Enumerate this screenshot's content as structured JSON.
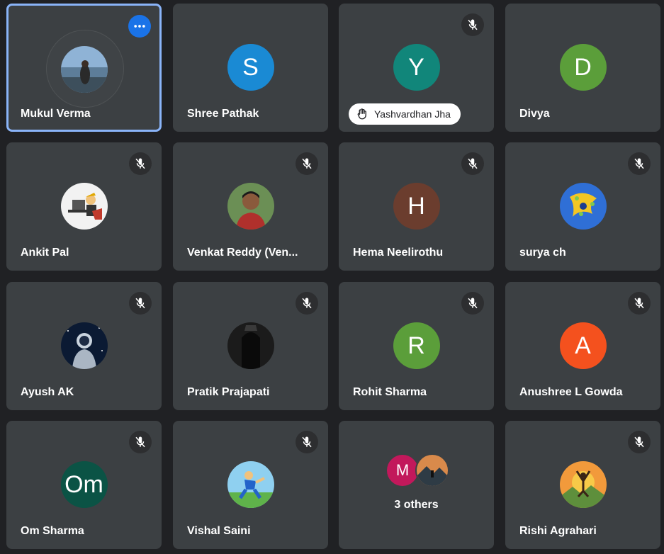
{
  "participants": [
    {
      "name": "Mukul Verma",
      "speaking": true,
      "muted": false,
      "avatar": "photo"
    },
    {
      "name": "Shree Pathak",
      "initial": "S",
      "color": "#1a8ad4"
    },
    {
      "name": "Yashvardhan Jha",
      "initial": "Y",
      "color": "#11867a",
      "hand_raised": true,
      "muted": true
    },
    {
      "name": "Divya",
      "initial": "D",
      "color": "#5b9e3a"
    },
    {
      "name": "Ankit Pal",
      "muted": true,
      "avatar": "photo"
    },
    {
      "name": "Venkat Reddy (Ven...",
      "muted": true,
      "avatar": "photo"
    },
    {
      "name": "Hema Neelirothu",
      "initial": "H",
      "color": "#6b3d2e",
      "muted": true
    },
    {
      "name": "surya ch",
      "muted": true,
      "avatar": "photo"
    },
    {
      "name": "Ayush AK",
      "muted": true,
      "avatar": "photo"
    },
    {
      "name": "Pratik Prajapati",
      "muted": true,
      "avatar": "photo"
    },
    {
      "name": "Rohit Sharma",
      "initial": "R",
      "color": "#5b9e3a",
      "muted": true
    },
    {
      "name": "Anushree L Gowda",
      "initial": "A",
      "color": "#f4511e",
      "muted": true
    },
    {
      "name": "Om Sharma",
      "initial": "Om",
      "color": "#0b5345",
      "muted": true
    },
    {
      "name": "Vishal Saini",
      "muted": true,
      "avatar": "photo"
    },
    {
      "name": "Rishi Agrahari",
      "muted": true,
      "avatar": "photo"
    }
  ],
  "others": {
    "label": "3 others",
    "initial": "M",
    "color": "#c2185b"
  },
  "icons": {
    "more": "more-options-icon",
    "mute": "mic-off-icon",
    "hand": "raise-hand-icon"
  }
}
